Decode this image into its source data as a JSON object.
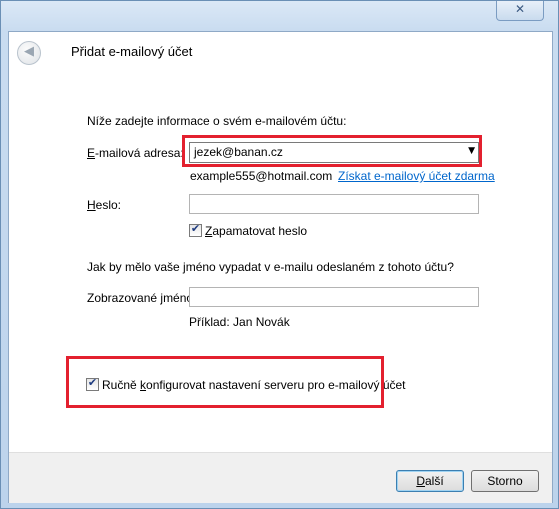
{
  "window": {
    "close_glyph": "✕",
    "back_glyph": "◀",
    "title": "Přidat e-mailový účet"
  },
  "form": {
    "intro": "Níže zadejte informace o svém e-mailovém účtu:",
    "email_label_accel": "E",
    "email_label_rest": "-mailová adresa:",
    "email_value": "jezek@banan.cz",
    "email_example": "example555@hotmail.com",
    "get_account_link": "Získat e-mailový účet zdarma",
    "password_label_accel": "H",
    "password_label_rest": "eslo:",
    "remember_accel": "Z",
    "remember_rest": "apamatovat heslo",
    "remember_checked": true,
    "name_question": "Jak by mělo vaše jméno vypadat v e-mailu odeslaném z tohoto účtu?",
    "display_name_label_pre": "Zobrazované ",
    "display_name_label_accel": "j",
    "display_name_label_post": "méno:",
    "display_name_example": "Příklad: Jan Novák",
    "manual_pre": "Ručně ",
    "manual_accel": "k",
    "manual_post": "onfigurovat nastavení serveru pro e-mailový účet",
    "manual_checked": true
  },
  "buttons": {
    "next_accel": "D",
    "next_rest": "alší",
    "cancel": "Storno"
  },
  "colors": {
    "highlight": "#e3202e",
    "link": "#0066cc"
  }
}
